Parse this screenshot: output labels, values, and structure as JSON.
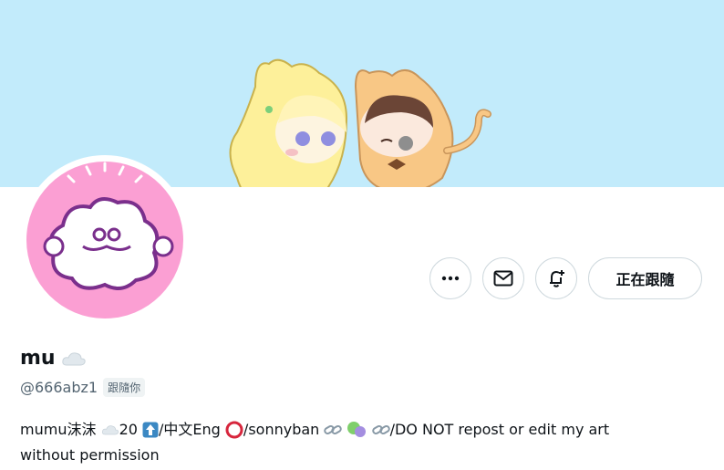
{
  "banner": {
    "bg_color": "#c2ebfb"
  },
  "avatar": {
    "bg_color": "#fb9fd3"
  },
  "actions": {
    "more_icon": "more-icon",
    "message_icon": "envelope-icon",
    "notify_icon": "bell-plus-icon",
    "follow_label": "正在跟隨"
  },
  "profile": {
    "display_name": "mu",
    "handle": "@666abz1",
    "follows_you": "跟隨你",
    "bio": {
      "t1": "mumu沫沫",
      "t2": "20",
      "t3": "/中文Eng",
      "t4": "/sonnyban",
      "t5": "/DO NOT repost or edit my art",
      "t6": "without permission"
    }
  }
}
